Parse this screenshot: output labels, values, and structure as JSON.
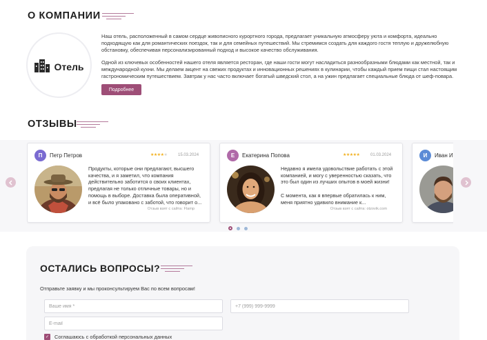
{
  "about": {
    "title": "О КОМПАНИИ",
    "logo_text": "Отель",
    "paragraph1": "Наш отель, расположенный в самом сердце живописного курортного города, предлагает уникальную атмосферу уюта и комфорта, идеально подходящую как для романтических поездок, так и для семейных путешествий. Мы стремимся создать для каждого гостя теплую и дружелюбную обстановку, обеспечивая персонализированный подход и высокое качество обслуживания.",
    "paragraph2": "Одной из ключевых особенностей нашего отеля является ресторан, где наши гости могут насладиться разнообразными блюдами как местной, так и международной кухни. Мы делаем акцент на свежих продуктах и инновационных решениях в кулинарии, чтобы каждый прием пищи стал настоящим гастрономическим путешествием. Завтрак у нас часто включает богатый шведский стол, а на ужин предлагает специальные блюда от шеф-повара.",
    "more_button": "Подробнее"
  },
  "reviews": {
    "title": "ОТЗЫВЫ",
    "items": [
      {
        "letter": "П",
        "name": "Петр Петров",
        "rating": 4,
        "date": "15.03.2024",
        "text": "Продукты, которые они предлагают, высшего качества, и я заметил, что компания действительно заботится о своих клиентах, предлагая не только отличные товары, но и помощь в выборе. Доставка была оперативной, и всё было упаковано с заботой, что говорит о...",
        "source": "Отзыв взят с сайта: Flamp"
      },
      {
        "letter": "Е",
        "name": "Екатерина Попова",
        "rating": 5,
        "date": "01.03.2024",
        "text": "Недавно я имела удовольствие работать с этой компанией, и могу с уверенностью сказать, что это был один из лучших опытов в моей жизни!\n\nС момента, как я впервые обратилась к ним, меня приятно удивило внимание к...",
        "source": "Отзыв взят с сайта: otzovik.com"
      },
      {
        "letter": "И",
        "name": "Иван И",
        "rating": 0,
        "date": "",
        "text": "",
        "source": ""
      }
    ]
  },
  "form": {
    "title": "ОСТАЛИСЬ ВОПРОСЫ?",
    "subtitle": "Отправьте заявку и мы проконсультируем Вас по всем вопросам!",
    "name_placeholder": "Ваше имя *",
    "phone_placeholder": "+7 (999) 999-9999",
    "email_placeholder": "E-mail",
    "consent_label": "Соглашаюсь с обработкой персональных данных"
  },
  "colors": {
    "accent": "#9e4e77",
    "avatar_p": "#7a6bd1",
    "avatar_e": "#b06aa8",
    "avatar_i": "#5b8bd6"
  },
  "icons": [
    "hotel-logo-icon",
    "chevron-left-icon",
    "chevron-right-icon",
    "star-icon",
    "check-icon"
  ]
}
